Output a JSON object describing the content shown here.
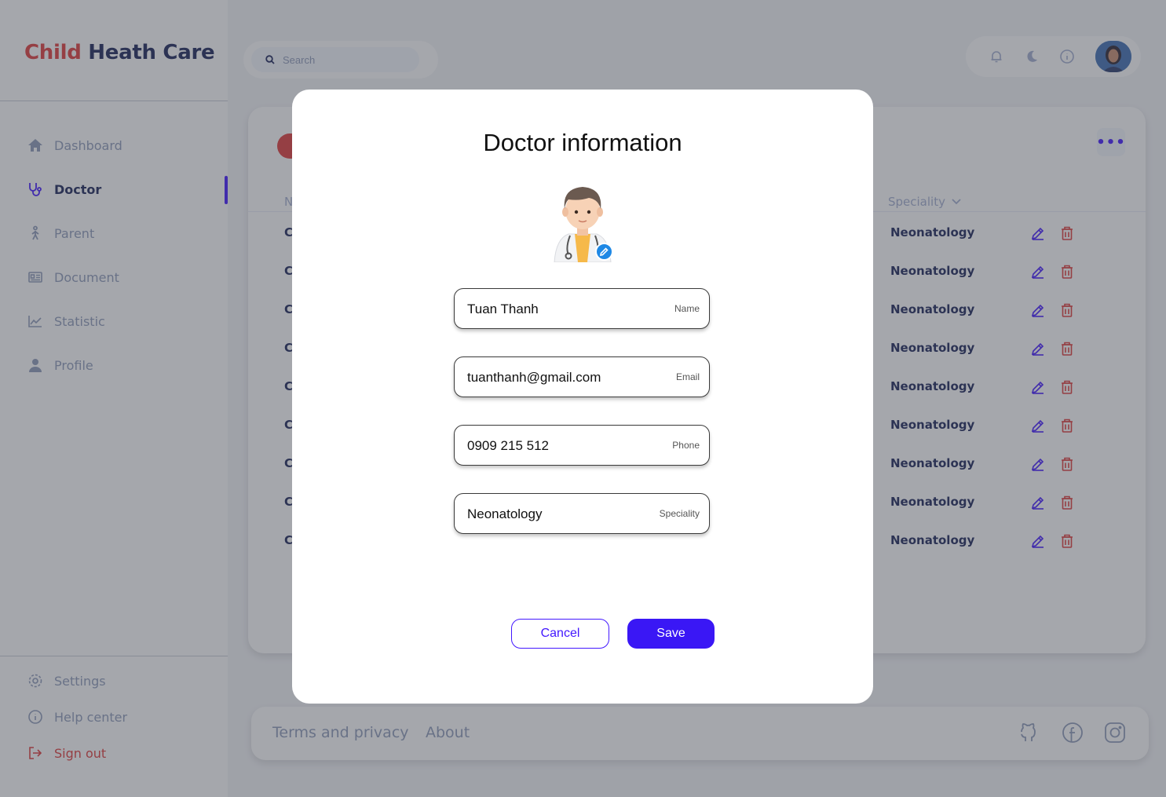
{
  "brand": {
    "part1": "Child",
    "part2": "Heath Care"
  },
  "sidebar": {
    "items": [
      {
        "label": "Dashboard",
        "icon": "home-icon"
      },
      {
        "label": "Doctor",
        "icon": "stethoscope-icon",
        "active": true
      },
      {
        "label": "Parent",
        "icon": "person-walking-icon"
      },
      {
        "label": "Document",
        "icon": "document-icon"
      },
      {
        "label": "Statistic",
        "icon": "chart-line-icon"
      },
      {
        "label": "Profile",
        "icon": "user-icon"
      }
    ],
    "bottom": [
      {
        "label": "Settings",
        "icon": "gear-icon"
      },
      {
        "label": "Help center",
        "icon": "info-icon"
      },
      {
        "label": "Sign out",
        "icon": "sign-out-icon"
      }
    ]
  },
  "search": {
    "placeholder": "Search"
  },
  "table": {
    "columns": [
      "N",
      "Speciality"
    ],
    "rows": [
      {
        "first": "C",
        "speciality": "Neonatology"
      },
      {
        "first": "C",
        "speciality": "Neonatology"
      },
      {
        "first": "C",
        "speciality": "Neonatology"
      },
      {
        "first": "C",
        "speciality": "Neonatology"
      },
      {
        "first": "C",
        "speciality": "Neonatology"
      },
      {
        "first": "C",
        "speciality": "Neonatology"
      },
      {
        "first": "C",
        "speciality": "Neonatology"
      },
      {
        "first": "C",
        "speciality": "Neonatology"
      },
      {
        "first": "C",
        "speciality": "Neonatology"
      }
    ],
    "more_label": "•••"
  },
  "footer": {
    "terms": "Terms and privacy",
    "about": "About"
  },
  "modal": {
    "title": "Doctor information",
    "fields": [
      {
        "label": "Name",
        "value": "Tuan Thanh"
      },
      {
        "label": "Email",
        "value": "tuanthanh@gmail.com"
      },
      {
        "label": "Phone",
        "value": "0909 215 512"
      },
      {
        "label": "Speciality",
        "value": "Neonatology"
      }
    ],
    "cancel": "Cancel",
    "save": "Save"
  },
  "colors": {
    "accent": "#4318FF",
    "brand_red": "#E03B3B",
    "navy": "#1B2559",
    "muted": "#8F9BBA"
  }
}
